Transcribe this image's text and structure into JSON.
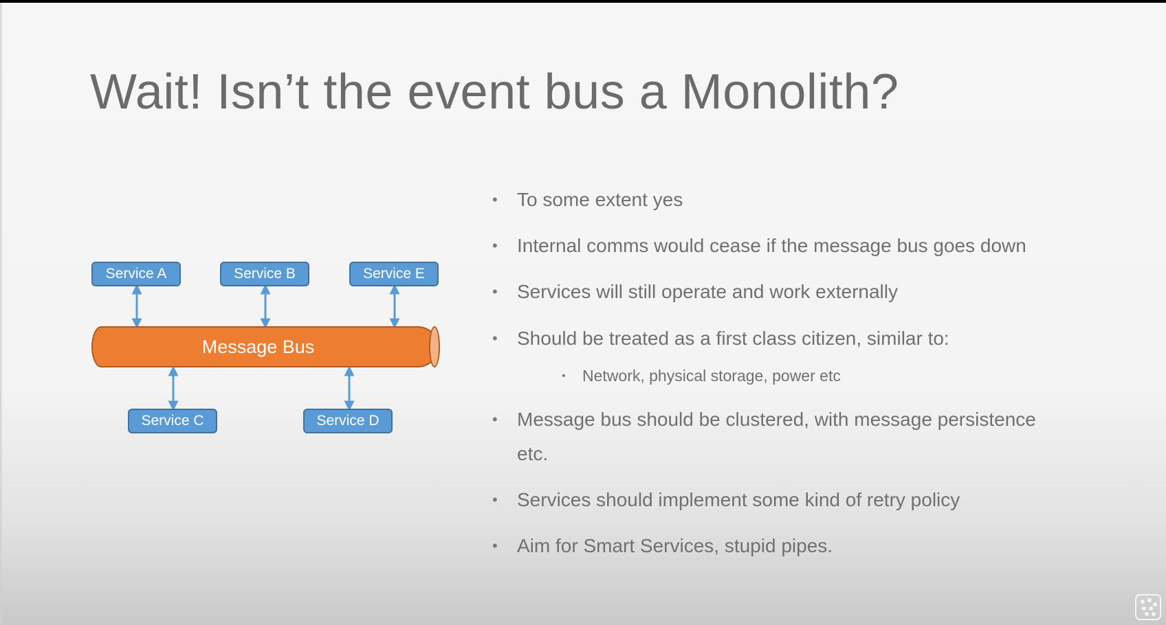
{
  "title": "Wait! Isn’t the event bus a Monolith?",
  "diagram": {
    "bus_label": "Message Bus",
    "services": {
      "a": "Service A",
      "b": "Service B",
      "e": "Service E",
      "c": "Service C",
      "d": "Service D"
    },
    "colors": {
      "service_fill": "#5b9bd5",
      "service_border": "#41719c",
      "bus_fill": "#ed7d31",
      "arrow": "#5b9bd5"
    }
  },
  "bullets": [
    "To some extent yes",
    "Internal comms would cease if the message bus goes down",
    "Services will still operate and work externally",
    "Should be treated as a first class citizen, similar to:",
    "Network, physical storage, power etc",
    "Message bus should be clustered, with message persistence",
    "etc.",
    "Services should implement some kind of retry policy",
    "Aim for Smart Services, stupid pipes."
  ],
  "bullet_glyph": "•",
  "icons": {
    "corner": "logo-icon"
  }
}
